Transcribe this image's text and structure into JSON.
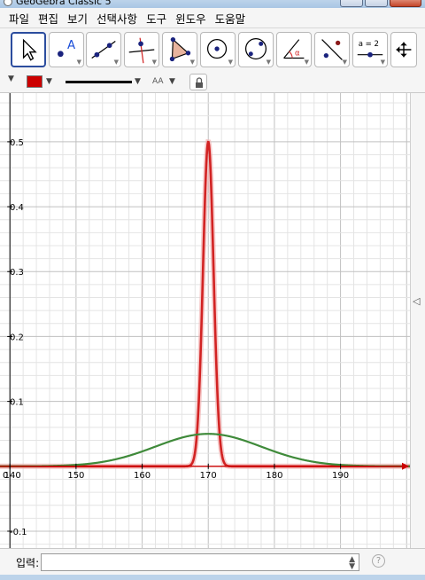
{
  "window": {
    "title": "GeoGebra Classic 5"
  },
  "menu": {
    "items": [
      "파일",
      "편집",
      "보기",
      "선택사항",
      "도구",
      "윈도우",
      "도움말"
    ]
  },
  "toolbar": {
    "tools": [
      {
        "name": "move-tool-icon"
      },
      {
        "name": "point-tool-icon",
        "glyph": "A"
      },
      {
        "name": "line-tool-icon"
      },
      {
        "name": "perpendicular-line-tool-icon"
      },
      {
        "name": "polygon-tool-icon"
      },
      {
        "name": "circle-center-point-tool-icon"
      },
      {
        "name": "circle-three-points-tool-icon"
      },
      {
        "name": "angle-tool-icon",
        "glyph": "α"
      },
      {
        "name": "reflect-tool-icon"
      },
      {
        "name": "slider-tool-icon",
        "glyph": "a = 2"
      },
      {
        "name": "move-graphics-view-tool-icon"
      }
    ],
    "colors": {
      "selected_border": "#2c4d9e"
    }
  },
  "stylebar": {
    "color_swatch": "#cc0000",
    "text_size_glyph": "AA",
    "lock_icon": "lock-icon"
  },
  "graphics": {
    "origin_label": "0",
    "x_ticks": [
      "140",
      "150",
      "160",
      "170",
      "180",
      "190"
    ],
    "y_ticks": [
      "0.5",
      "0.4",
      "0.3",
      "0.2",
      "0.1",
      "-0.1"
    ],
    "curve_colors": {
      "narrow": "#d22323",
      "wide": "#3f8a3a",
      "axis": "#cc0000"
    }
  },
  "chart_data": {
    "type": "line",
    "xlim": [
      138.5,
      200.5
    ],
    "ylim": [
      -0.126,
      0.575
    ],
    "x_ticks": [
      140,
      150,
      160,
      170,
      180,
      190
    ],
    "y_ticks": [
      -0.1,
      0.1,
      0.2,
      0.3,
      0.4,
      0.5
    ],
    "grid": true,
    "series": [
      {
        "kind": "normal-density",
        "mean": 170,
        "sd": 0.8,
        "peak": 0.5,
        "color": "#d22323"
      },
      {
        "kind": "normal-density",
        "mean": 170,
        "sd": 8,
        "peak": 0.05,
        "color": "#3f8a3a"
      }
    ]
  },
  "input": {
    "label": "입력:",
    "value": "",
    "help_glyph": "?"
  }
}
